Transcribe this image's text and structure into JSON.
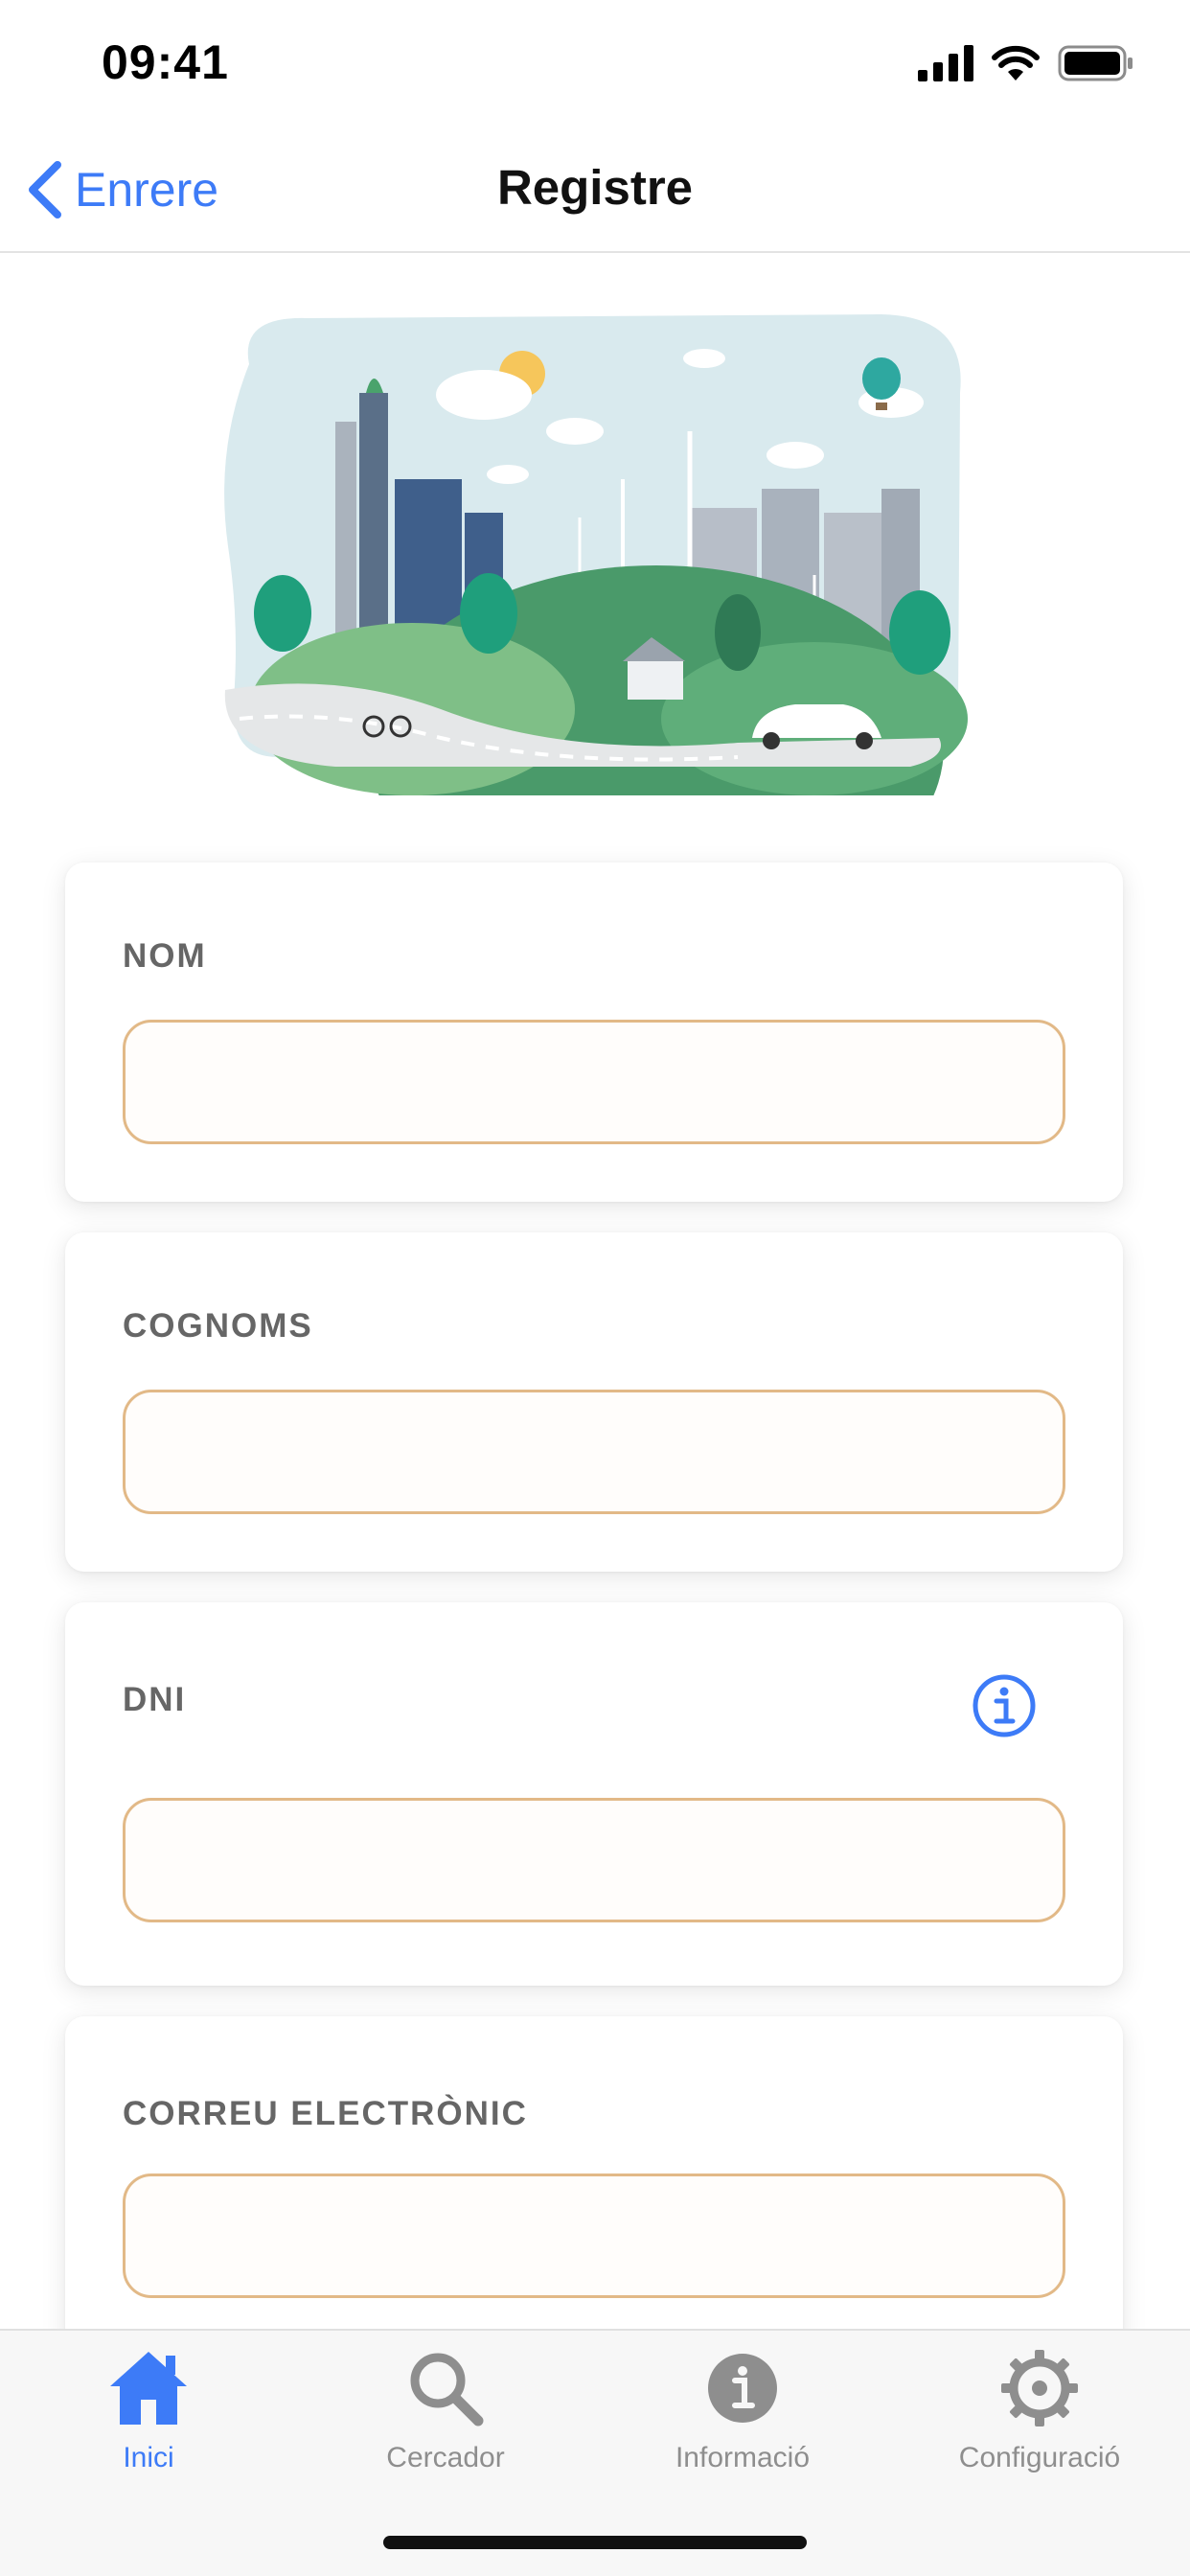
{
  "status_bar": {
    "time": "09:41"
  },
  "nav": {
    "back_label": "Enrere",
    "title": "Registre"
  },
  "form": {
    "fields": [
      {
        "label": "NOM",
        "value": ""
      },
      {
        "label": "COGNOMS",
        "value": ""
      },
      {
        "label": "DNI",
        "value": ""
      },
      {
        "label": "CORREU ELECTRÒNIC",
        "value": ""
      }
    ]
  },
  "tabs": [
    {
      "label": "Inici",
      "icon": "home-icon",
      "active": true
    },
    {
      "label": "Cercador",
      "icon": "search-icon",
      "active": false
    },
    {
      "label": "Informació",
      "icon": "info-icon",
      "active": false
    },
    {
      "label": "Configuració",
      "icon": "gear-icon",
      "active": false
    }
  ],
  "colors": {
    "accent": "#3d7bf7",
    "field_border": "#e2b987",
    "label": "#666666",
    "tab_inactive": "#8e8e8e"
  }
}
